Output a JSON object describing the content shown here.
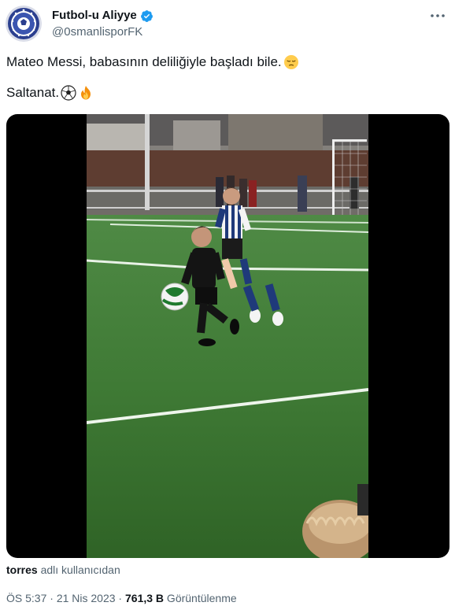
{
  "author": {
    "display_name": "Futbol-u Aliyye",
    "handle": "@0smanlisporFK",
    "verified": true,
    "avatar_icon": "club-crest-icon"
  },
  "more_icon": "more-horizontal-icon",
  "tweet": {
    "line1": "Mateo Messi,  babasının deliliğiyle başladı bile.",
    "line1_emoji": "pensive-face-emoji",
    "line2": "Saltanat.",
    "line2_emojis": [
      "soccer-ball-emoji",
      "fire-emoji"
    ]
  },
  "media": {
    "type": "video",
    "scene": "youth-football-match"
  },
  "attribution": {
    "user": "torres",
    "suffix": " adlı kullanıcıdan"
  },
  "meta": {
    "time": "ÖS 5:37",
    "separator": " · ",
    "date": "21 Nis 2023",
    "views_count": "761,3 B",
    "views_label": " Görüntülenme"
  },
  "colors": {
    "text": "#0f1419",
    "secondary": "#536471",
    "verified": "#1d9bf0"
  }
}
